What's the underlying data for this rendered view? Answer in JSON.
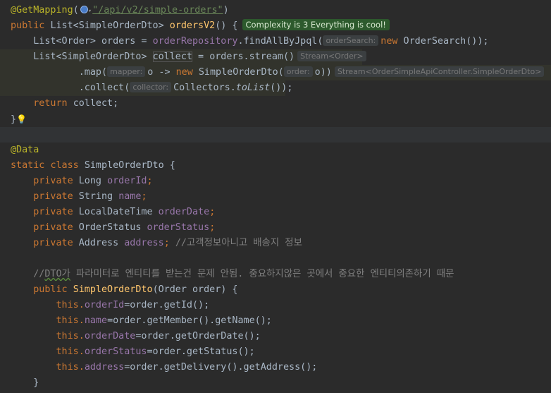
{
  "code": {
    "get_mapping": "@GetMapping",
    "endpoint": "\"/api/v2/simple-orders\"",
    "public": "public",
    "list_dto_type": "List<SimpleOrderDto>",
    "method_name": "ordersV2",
    "complexity_badge": "Complexity is 3 Everything is cool!",
    "list_order": "List<Order>",
    "orders_var": "orders",
    "repo_field": "orderRepository",
    "find_call": ".findAllByJpql(",
    "hint_order_search": "orderSearch:",
    "new_kw": "new",
    "order_search_ctor": "OrderSearch());",
    "collect_var": "collect",
    "stream_call": "orders.stream()",
    "hint_stream_order": "Stream<Order>",
    "map_call": ".map(",
    "hint_mapper": "mapper:",
    "lambda": "o ->",
    "dto_ctor": "SimpleOrderDto(",
    "hint_order": "order:",
    "o_close": "o))",
    "hint_stream_dto": "Stream<OrderSimpleApiController.SimpleOrderDto>",
    "collect_call": ".collect(",
    "hint_collector": "collector:",
    "collectors": "Collectors.",
    "to_list": "toList",
    "to_list_close": "());",
    "return_kw": "return",
    "return_value": "collect;",
    "close_brace": "}",
    "data_ann": "@Data",
    "static_kw": "static",
    "class_kw": "class",
    "class_name": "SimpleOrderDto {",
    "private": "private",
    "type_long": "Long",
    "field_order_id": "orderId",
    "type_string": "String",
    "field_name": "name",
    "type_ldt": "LocalDateTime",
    "field_order_date": "orderDate",
    "type_status": "OrderStatus",
    "field_order_status": "orderStatus",
    "type_address": "Address",
    "field_address": "address",
    "comment_address": "//고객정보아니고 배송지 정보",
    "comment_dto_slashes": "//",
    "comment_dto_word": "DTO가",
    "comment_dto_rest": " 파라미터로 엔티티를 받는건 문제 안됨. 중요하지않은 곳에서 중요한 엔티티의존하기 때문",
    "ctor_name": "SimpleOrderDto",
    "ctor_params": "(Order order) {",
    "this_kw": "this.",
    "assign_id": "=order.getId();",
    "assign_name": "=order.getMember().getName();",
    "assign_date": "=order.getOrderDate();",
    "assign_status": "=order.getStatus();",
    "assign_address": "=order.getDelivery().getAddress();"
  }
}
